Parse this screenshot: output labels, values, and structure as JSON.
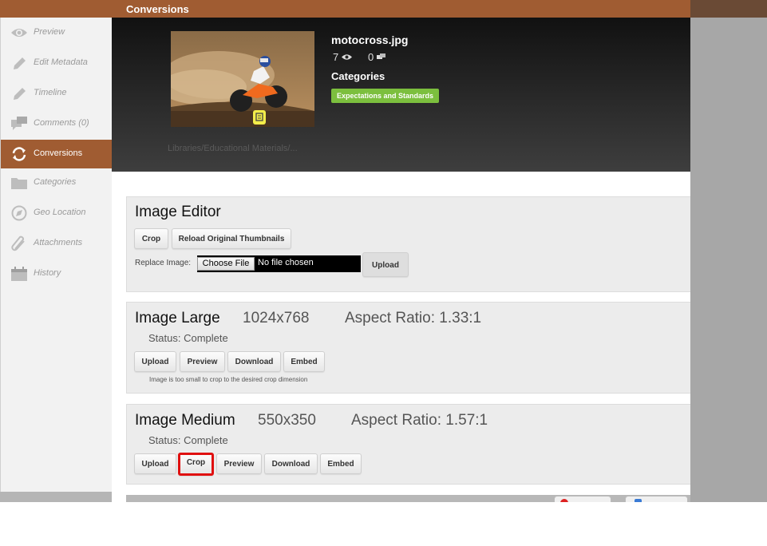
{
  "window": {
    "title": "Conversions"
  },
  "sidebar": {
    "items": [
      {
        "label": "Preview",
        "icon": "eye-icon"
      },
      {
        "label": "Edit Metadata",
        "icon": "pencil-icon"
      },
      {
        "label": "Timeline",
        "icon": "pencil-icon"
      },
      {
        "label": "Comments (0)",
        "icon": "comments-icon"
      },
      {
        "label": "Conversions",
        "icon": "refresh-icon",
        "active": true
      },
      {
        "label": "Categories",
        "icon": "folder-icon"
      },
      {
        "label": "Geo Location",
        "icon": "compass-icon"
      },
      {
        "label": "Attachments",
        "icon": "paperclip-icon"
      },
      {
        "label": "History",
        "icon": "calendar-icon"
      }
    ]
  },
  "asset": {
    "filename": "motocross.jpg",
    "views": "7",
    "comments": "0",
    "categories_label": "Categories",
    "category_tag": "Expectations and Standards",
    "path": "Libraries/Educational Materials/..."
  },
  "image_editor": {
    "title": "Image Editor",
    "crop_label": "Crop",
    "reload_label": "Reload Original Thumbnails",
    "replace_label": "Replace Image:",
    "choose_file_label": "Choose File",
    "no_file_text": "No file chosen",
    "upload_label": "Upload"
  },
  "image_large": {
    "title": "Image Large",
    "dimensions": "1024x768",
    "aspect": "Aspect Ratio: 1.33:1",
    "status": "Status: Complete",
    "buttons": [
      "Upload",
      "Preview",
      "Download",
      "Embed"
    ],
    "note": "Image is too small to crop to the desired crop dimension"
  },
  "image_medium": {
    "title": "Image Medium",
    "dimensions": "550x350",
    "aspect": "Aspect Ratio: 1.57:1",
    "status": "Status: Complete",
    "buttons": [
      "Upload",
      "Crop",
      "Preview",
      "Download",
      "Embed"
    ]
  },
  "colors": {
    "accent": "#a05c32",
    "tag": "#7cbf3e",
    "highlight": "#e01010"
  }
}
